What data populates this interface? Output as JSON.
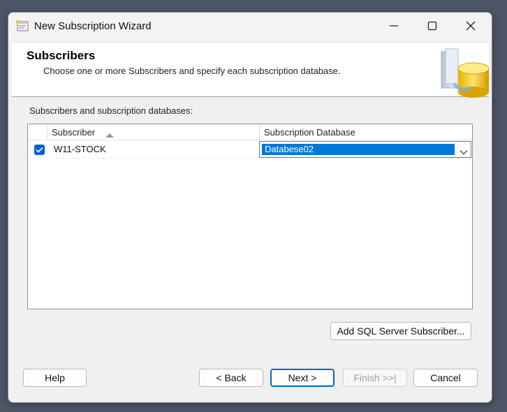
{
  "window": {
    "title": "New Subscription Wizard",
    "icon": "wizard-app-icon",
    "controls": [
      "minimize-icon",
      "maximize-icon",
      "close-icon"
    ]
  },
  "header": {
    "title": "Subscribers",
    "subtitle": "Choose one or more Subscribers and specify each subscription database.",
    "graphic": "database-server-icon"
  },
  "grid": {
    "label": "Subscribers and subscription databases:",
    "columns": {
      "subscriber": "Subscriber",
      "database": "Subscription Database"
    },
    "rows": [
      {
        "checked": true,
        "subscriber": "W11-STOCK",
        "database": "Databese02"
      }
    ]
  },
  "buttons": {
    "add_subscriber": "Add SQL Server Subscriber...",
    "help": "Help",
    "back": "< Back",
    "next": "Next >",
    "finish": "Finish >>|",
    "cancel": "Cancel"
  },
  "colors": {
    "accent": "#0078d7",
    "checkbox": "#0a5fd6",
    "window_bg": "#f0f0f0"
  }
}
